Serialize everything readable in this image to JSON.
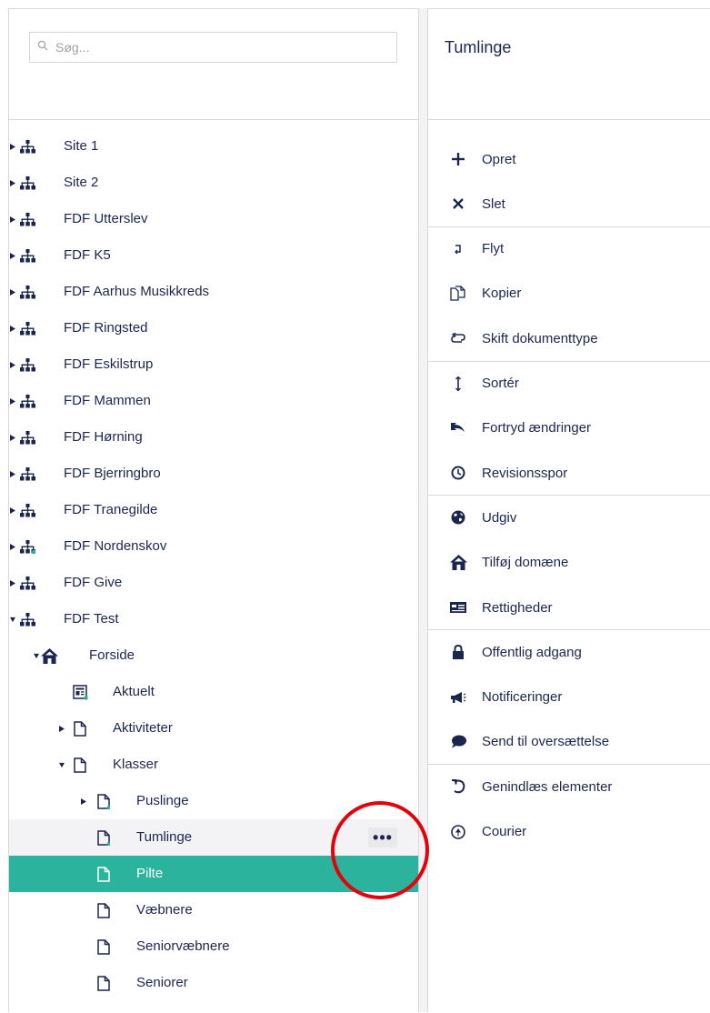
{
  "search": {
    "placeholder": "Søg..."
  },
  "tree": {
    "root_sites": [
      {
        "label": "Site 1",
        "icon": "sitemap-icon"
      },
      {
        "label": "Site 2",
        "icon": "sitemap-icon"
      },
      {
        "label": "FDF Utterslev",
        "icon": "sitemap-icon"
      },
      {
        "label": "FDF K5",
        "icon": "sitemap-icon"
      },
      {
        "label": "FDF Aarhus Musikkreds",
        "icon": "sitemap-icon"
      },
      {
        "label": "FDF Ringsted",
        "icon": "sitemap-icon"
      },
      {
        "label": "FDF Eskilstrup",
        "icon": "sitemap-icon"
      },
      {
        "label": "FDF Mammen",
        "icon": "sitemap-icon"
      },
      {
        "label": "FDF Hørning",
        "icon": "sitemap-icon"
      },
      {
        "label": "FDF Bjerringbro",
        "icon": "sitemap-icon"
      },
      {
        "label": "FDF Tranegilde",
        "icon": "sitemap-icon"
      },
      {
        "label": "FDF Nordenskov",
        "icon": "sitemap-icon"
      },
      {
        "label": "FDF Give",
        "icon": "sitemap-icon"
      },
      {
        "label": "FDF Test",
        "icon": "sitemap-icon"
      }
    ],
    "forside": {
      "label": "Forside",
      "icon": "home-icon"
    },
    "forside_children": [
      {
        "label": "Aktuelt",
        "icon": "news-list-icon"
      },
      {
        "label": "Aktiviteter",
        "icon": "document-icon"
      },
      {
        "label": "Klasser",
        "icon": "document-icon"
      }
    ],
    "klasser_children": [
      {
        "label": "Puslinge",
        "icon": "document-icon"
      },
      {
        "label": "Tumlinge",
        "icon": "document-icon"
      },
      {
        "label": "Pilte",
        "icon": "document-icon"
      },
      {
        "label": "Væbnere",
        "icon": "document-icon"
      },
      {
        "label": "Seniorvæbnere",
        "icon": "document-icon"
      },
      {
        "label": "Seniorer",
        "icon": "document-icon"
      }
    ],
    "more_button": "•••"
  },
  "actions_panel": {
    "title": "Tumlinge",
    "items": [
      {
        "label": "Opret",
        "icon": "plus-icon"
      },
      {
        "label": "Slet",
        "icon": "x-icon"
      },
      {
        "label": "Flyt",
        "icon": "move-icon"
      },
      {
        "label": "Kopier",
        "icon": "copy-icon"
      },
      {
        "label": "Skift dokumenttype",
        "icon": "swap-icon"
      },
      {
        "label": "Sortér",
        "icon": "sort-icon"
      },
      {
        "label": "Fortryd ændringer",
        "icon": "undo-icon"
      },
      {
        "label": "Revisionsspor",
        "icon": "clock-icon"
      },
      {
        "label": "Udgiv",
        "icon": "globe-icon"
      },
      {
        "label": "Tilføj domæne",
        "icon": "home-icon"
      },
      {
        "label": "Rettigheder",
        "icon": "id-card-icon"
      },
      {
        "label": "Offentlig adgang",
        "icon": "lock-icon"
      },
      {
        "label": "Notificeringer",
        "icon": "megaphone-icon"
      },
      {
        "label": "Send til oversættelse",
        "icon": "speech-bubble-icon"
      },
      {
        "label": "Genindlæs elementer",
        "icon": "reload-icon"
      },
      {
        "label": "Courier",
        "icon": "courier-icon"
      }
    ]
  },
  "colors": {
    "selected": "#2bb39e",
    "highlight_circle": "#e5000b",
    "text": "#1b264f"
  }
}
